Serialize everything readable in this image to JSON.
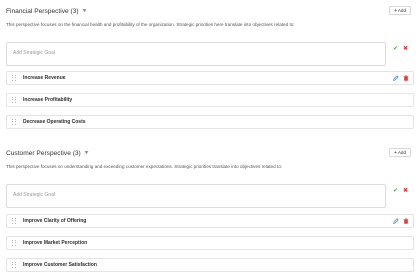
{
  "sections": [
    {
      "title": "Financial Perspective (3)",
      "add_label": "Add",
      "description": "This perspective focuses on the financial health and profitability of the organization. Strategic priorities here translate into objectives related to:",
      "goal_placeholder": "Add Strategic Goal",
      "items": [
        {
          "label": "Increase Revenue"
        },
        {
          "label": "Increase Profitability"
        },
        {
          "label": "Decrease Operating Costs"
        }
      ]
    },
    {
      "title": "Customer Perspective (3)",
      "add_label": "Add",
      "description": "This perspective focuses on understanding and exceeding customer expectations. Strategic priorities translate into objectives related to:",
      "goal_placeholder": "Add Strategic Goal",
      "items": [
        {
          "label": "Improve Clarity of Offering"
        },
        {
          "label": "Improve Market Perception"
        },
        {
          "label": "Improve Customer Satisfaction"
        }
      ]
    }
  ],
  "icons": {
    "expand": "chevron-down-icon",
    "add": "plus-icon",
    "confirm": "check-icon",
    "cancel": "close-icon",
    "drag": "drag-handle-icon",
    "edit": "pencil-icon",
    "delete": "trash-icon"
  },
  "colors": {
    "confirm": "#4caf50",
    "cancel": "#e53935",
    "edit": "#3b7ddd",
    "delete": "#e53935"
  }
}
